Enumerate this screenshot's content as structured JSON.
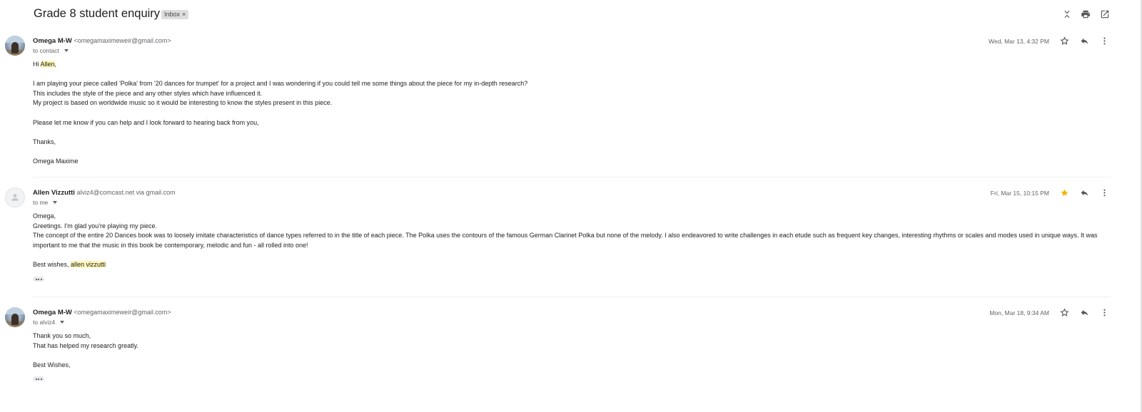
{
  "thread": {
    "subject": "Grade 8 student enquiry",
    "label": "Inbox",
    "label_remove": "×"
  },
  "toolbar_icons": [
    "collapse-all-icon",
    "print-icon",
    "open-in-new-window-icon"
  ],
  "messages": [
    {
      "sender_name": "Omega M-W",
      "sender_email": "<omegamaximeweir@gmail.com>",
      "to": "to contact",
      "date": "Wed, Mar 13, 4:32 PM",
      "starred": false,
      "avatar": "photo",
      "body": {
        "greeting_prefix": "Hi ",
        "greeting_name": "Allen",
        "greeting_suffix": ",",
        "line1": "I am playing your piece called 'Polka' from '20 dances for trumpet' for a project and I was wondering if you could tell me some things about the piece for my in-depth research?",
        "line2": "This includes the style of the piece and any other styles which have influenced it.",
        "line3": "My project is based on worldwide music so it would be interesting to know the styles present in this piece.",
        "line4": "Please let me know if you can help and I look forward to hearing back from you,",
        "line5": "Thanks,",
        "line6": "Omega Maxime"
      }
    },
    {
      "sender_name": "Allen Vizzutti",
      "sender_email": "alviz4@comcast.net via gmail.com",
      "to": "to me",
      "date": "Fri, Mar 15, 10:15 PM",
      "starred": true,
      "avatar": "blank",
      "body": {
        "line1": "Omega,",
        "line2": "Greetings. I'm glad you're playing my piece.",
        "line3": "The concept of the entire 20 Dances book was to loosely imitate characteristics of dance types referred to in the title of each piece. The Polka uses the contours of the famous German Clarinet Polka but none of the melody. I also endeavored to write challenges in each etude such as frequent key changes, interesting rhythms or scales and modes used in unique ways. It was important to me that the music in this book be contemporary, melodic and fun - all rolled into one!",
        "signoff_prefix": "Best wishes, ",
        "signoff_name": "allen vizzutti"
      }
    },
    {
      "sender_name": "Omega M-W",
      "sender_email": "<omegamaximeweir@gmail.com>",
      "to": "to alviz4",
      "date": "Mon, Mar 18, 9:34 AM",
      "starred": false,
      "avatar": "photo",
      "body": {
        "line1": "Thank you so much,",
        "line2": "That has helped my research greatly.",
        "line3": "Best Wishes,"
      }
    }
  ],
  "colors": {
    "star_filled": "#f4b400",
    "highlight": "#fdf6b8",
    "icon": "#555555"
  }
}
